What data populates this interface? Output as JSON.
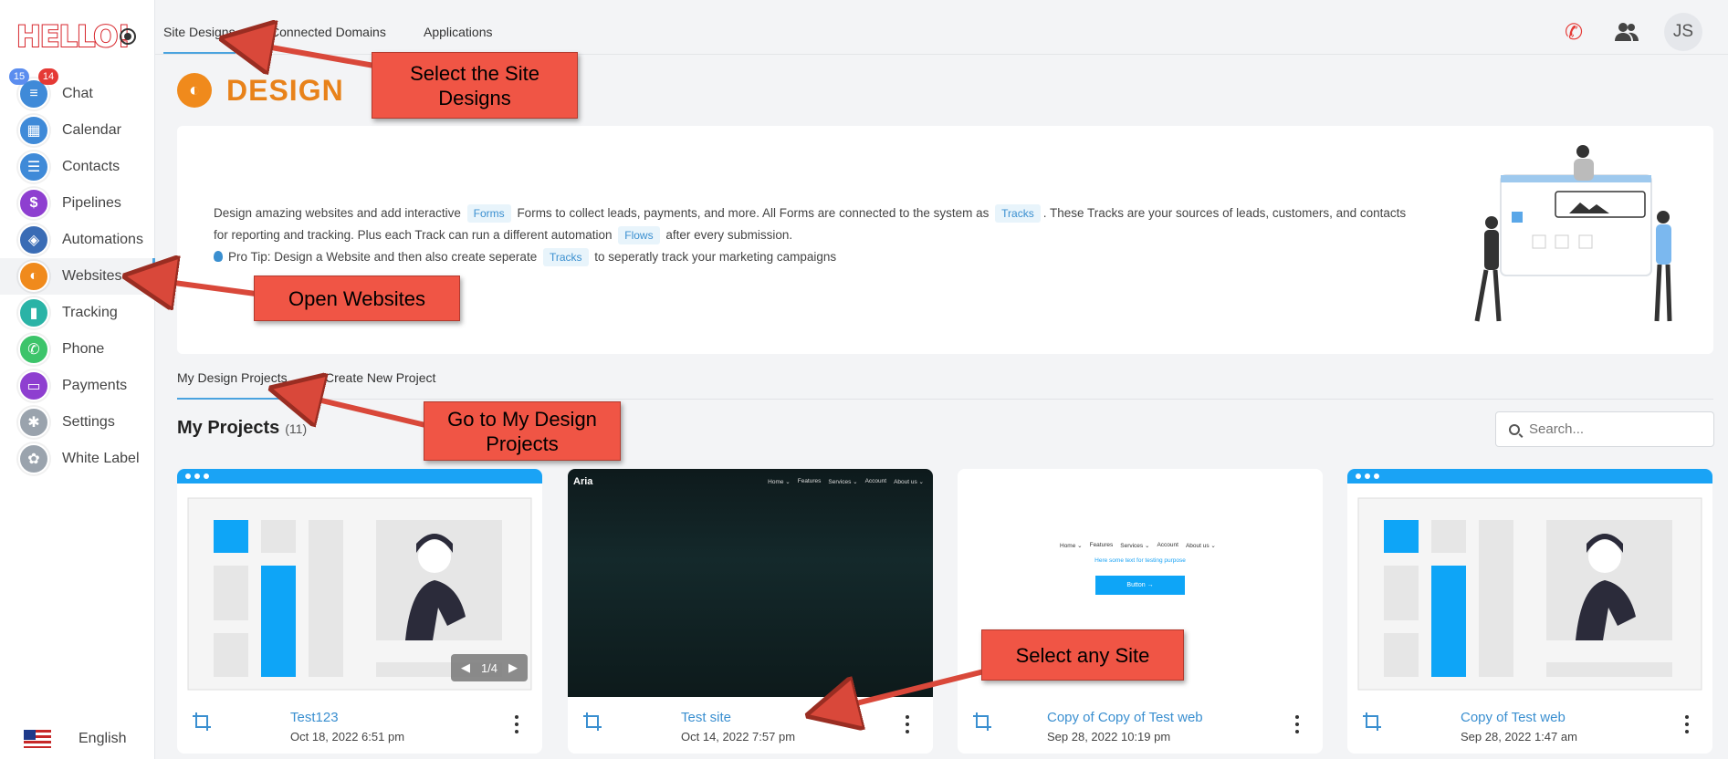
{
  "brand": {
    "logo_text": "HELLO!"
  },
  "sidebar": {
    "badges": {
      "blue": "15",
      "red": "14"
    },
    "items": [
      {
        "label": "Chat",
        "color": "#3f8ad8",
        "glyph": "≡"
      },
      {
        "label": "Calendar",
        "color": "#3f8ad8",
        "glyph": "▦"
      },
      {
        "label": "Contacts",
        "color": "#3f8ad8",
        "glyph": "☰"
      },
      {
        "label": "Pipelines",
        "color": "#8e3fd0",
        "glyph": "$"
      },
      {
        "label": "Automations",
        "color": "#3a6cb5",
        "glyph": "◈"
      },
      {
        "label": "Websites",
        "color": "#f08a1c",
        "glyph": "◐"
      },
      {
        "label": "Tracking",
        "color": "#2ab3a6",
        "glyph": "▮"
      },
      {
        "label": "Phone",
        "color": "#3cc46a",
        "glyph": "✆"
      },
      {
        "label": "Payments",
        "color": "#8e3fd0",
        "glyph": "▭"
      },
      {
        "label": "Settings",
        "color": "#9aa3ad",
        "glyph": "✱"
      },
      {
        "label": "White Label",
        "color": "#9aa3ad",
        "glyph": "✿"
      }
    ],
    "language": "English"
  },
  "topbar": {
    "tabs": [
      "Site Designs",
      "Connected Domains",
      "Applications"
    ],
    "avatar_initials": "JS"
  },
  "page": {
    "title": "DESIGN",
    "intro": {
      "line1_a": "Design amazing websites and add interactive",
      "chip_forms": "Forms",
      "line1_b": "Forms to collect leads, payments, and more. All Forms are connected to the system as",
      "chip_tracks": "Tracks",
      "line1_c": ". These Tracks are your sources of leads, customers, and contacts",
      "line2_a": "for reporting and tracking. Plus each Track can run a different automation",
      "chip_flows": "Flows",
      "line2_b": "after every submission.",
      "line3_a": "Pro Tip: Design a Website and then also create seperate",
      "chip_tracks2": "Tracks",
      "line3_b": "to seperatly track your marketing campaigns"
    },
    "subtabs": [
      "My Design Projects",
      "Create New Project"
    ],
    "projects_title": "My Projects",
    "projects_count": "(11)",
    "search_placeholder": "Search..."
  },
  "cards": [
    {
      "name": "Test123",
      "date": "Oct 18, 2022 6:51 pm",
      "pager": "1/4"
    },
    {
      "name": "Test site",
      "date": "Oct 14, 2022 7:57 pm",
      "brand": "Aria",
      "nav": [
        "Home ⌄",
        "Features",
        "Services ⌄",
        "Account",
        "About us ⌄"
      ]
    },
    {
      "name": "Copy of Copy of Test web",
      "date": "Sep 28, 2022 10:19 pm",
      "nav": [
        "Home ⌄",
        "Features",
        "Services ⌄",
        "Account",
        "About us ⌄"
      ],
      "tagline": "Here some text for testing purpose",
      "button": "Button →"
    },
    {
      "name": "Copy of Test web",
      "date": "Sep 28, 2022 1:47 am"
    }
  ],
  "callouts": {
    "site_designs": "Select the Site Designs",
    "open_websites": "Open Websites",
    "my_design": "Go to My Design Projects",
    "select_site": "Select any Site"
  },
  "colors": {
    "accent": "#4aa3df",
    "brand_orange": "#e8821a",
    "callout": "#f05545",
    "phone_red": "#e53935"
  }
}
